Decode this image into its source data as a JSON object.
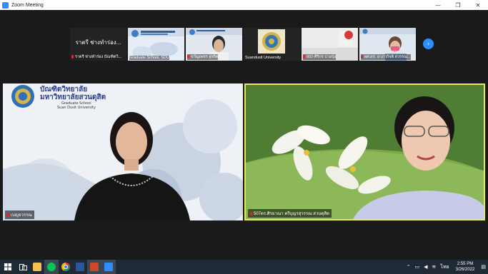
{
  "window": {
    "title": "Zoom Meeting",
    "controls": [
      "—",
      "❐",
      "✕"
    ]
  },
  "strip": [
    {
      "name": "ราตรี ช่างทำร่อง บัณฑิตวิ...",
      "big_name": "ราตรี ช่างทำร่อง...",
      "type": "name"
    },
    {
      "name": "Graduate School, SDU",
      "type": "logo"
    },
    {
      "name": "ขวัญเพชร สุจริต",
      "type": "person",
      "muted": true
    },
    {
      "name": "Suandusit University",
      "type": "logo"
    },
    {
      "name": "602-ศิริกร บ่ายบุ้ง",
      "type": "person",
      "muted": true
    },
    {
      "name": "ผศ.ดร. อาภากิจติ สวรรณ...",
      "type": "person",
      "muted": true
    }
  ],
  "videos": {
    "left": {
      "name": "เบญจวรรณ",
      "logo_line1": "บัณฑิตวิทยาลัย",
      "logo_line2": "มหาวิทยาลัยสวนดุสิต",
      "logo_line3": "Graduate School",
      "logo_line4": "Suan Dusit University"
    },
    "right": {
      "name": "507ดร.ศิรยาณา ตรีบุญรสุวรรณ สวนดุสิต"
    }
  },
  "taskbar": {
    "time": "2:55 PM",
    "date": "3/26/2022",
    "lang": "ไทย",
    "apps": [
      "start-icon",
      "taskview-icon",
      "file-explorer-icon",
      "line-icon",
      "chrome-icon",
      "word-icon",
      "powerpoint-icon",
      "zoom-icon"
    ]
  },
  "colors": {
    "zoom_blue": "#2d8cff",
    "active_border": "#e8e85a",
    "taskbar": "#1f2a36"
  }
}
